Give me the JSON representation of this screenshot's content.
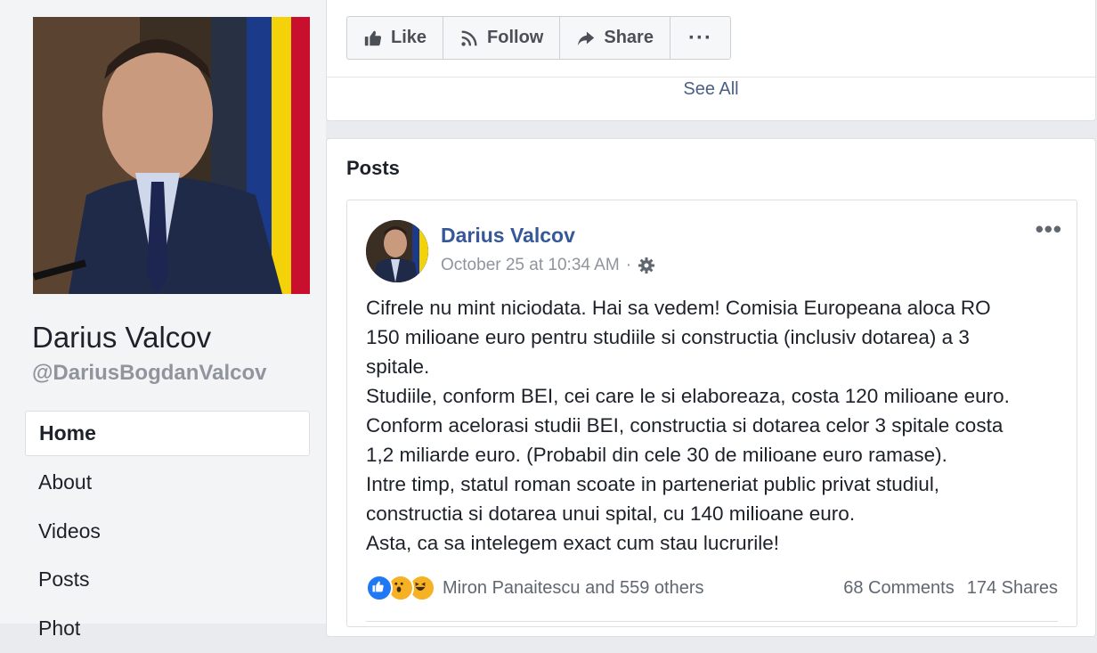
{
  "profile": {
    "name": "Darius Valcov",
    "handle": "@DariusBogdanValcov"
  },
  "nav": {
    "items": [
      {
        "label": "Home",
        "active": true
      },
      {
        "label": "About"
      },
      {
        "label": "Videos"
      },
      {
        "label": "Posts"
      },
      {
        "label": "Phot"
      }
    ]
  },
  "actions": {
    "like": "Like",
    "follow": "Follow",
    "share": "Share",
    "more": "···"
  },
  "see_all": "See All",
  "posts": {
    "heading": "Posts",
    "post": {
      "author": "Darius Valcov",
      "timestamp": "October 25 at 10:34 AM",
      "separator": "·",
      "options": "•••",
      "lines": [
        "Cifrele nu mint niciodata. Hai sa vedem! Comisia Europeana aloca RO",
        "150 milioane euro pentru studiile si constructia (inclusiv dotarea) a 3",
        "spitale.",
        "Studiile, conform BEI, cei care le si elaboreaza, costa 120 milioane euro.",
        "Conform acelorasi studii BEI, constructia si dotarea celor 3 spitale costa",
        "1,2 miliarde euro. (Probabil din cele 30 de milioane euro ramase).",
        "Intre timp, statul roman scoate in parteneriat public privat studiul,",
        "constructia si dotarea unui spital, cu 140 milioane euro.",
        "Asta, ca sa intelegem exact cum stau lucrurile!"
      ],
      "reactions_text": "Miron Panaitescu and 559 others",
      "comments": "68 Comments",
      "shares": "174 Shares"
    }
  },
  "colors": {
    "link_blue": "#365899",
    "like_blue": "#2078f4",
    "wow_yellow": "#f7b125"
  }
}
